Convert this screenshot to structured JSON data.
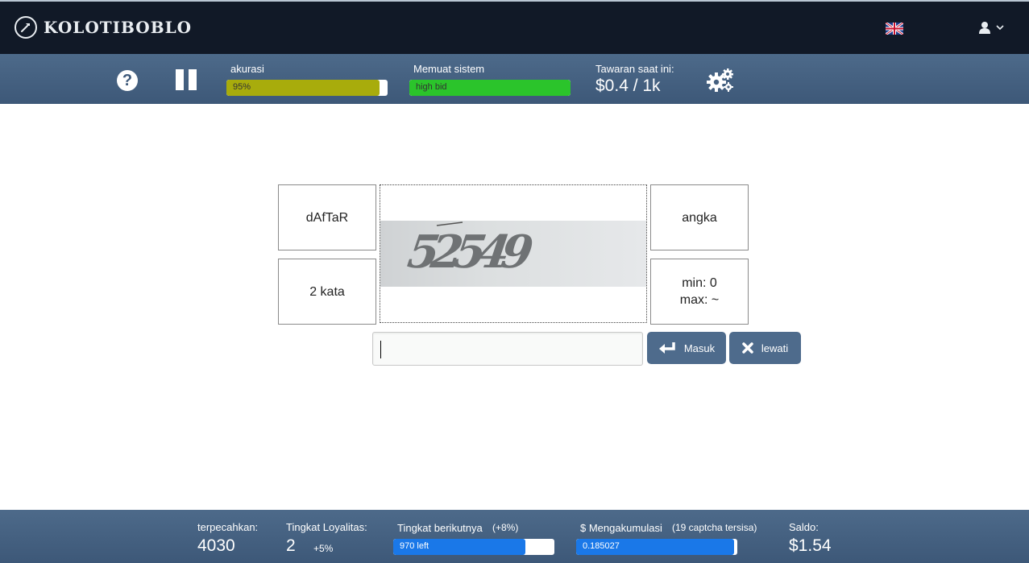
{
  "topnav": {
    "logo_text": "KOLOTIBOBLO",
    "language_flag": "uk-flag-icon",
    "user_icon": "user-icon"
  },
  "toolbar": {
    "help_icon": "question-icon",
    "pause_icon": "pause-icon",
    "accuracy": {
      "label": "akurasi",
      "value_text": "95%",
      "fraction": 0.95,
      "color": "#a8ac0c"
    },
    "system_load": {
      "label": "Memuat sistem",
      "value_text": "high bid",
      "fraction": 1.0,
      "color": "#2bc42b"
    },
    "current_bid": {
      "label": "Tawaran saat ini:",
      "value": "$0.4 / 1k"
    },
    "settings_icon": "gears-icon"
  },
  "captcha": {
    "case_hint": "dAfTaR",
    "type_hint": "angka",
    "words_hint": "2 kata",
    "min_hint": "min: 0",
    "max_hint": "max: ~",
    "image_text": "52549",
    "input_value": "",
    "submit_label": "Masuk",
    "skip_label": "lewati"
  },
  "footer": {
    "solved": {
      "label": "terpecahkan:",
      "value": "4030"
    },
    "loyalty": {
      "label": "Tingkat Loyalitas:",
      "value": "2",
      "bonus": "+5%"
    },
    "next_level": {
      "label": "Tingkat berikutnya",
      "bonus": "(+8%)",
      "bar_text": "970 left",
      "fraction": 0.82,
      "color": "#1a78e8"
    },
    "accumulate": {
      "label": "$ Mengakumulasi",
      "note": "(19 captcha tersisa)",
      "bar_text": "0.185027",
      "fraction": 0.98,
      "color": "#1a78e8"
    },
    "balance": {
      "label": "Saldo:",
      "value": "$1.54"
    }
  }
}
